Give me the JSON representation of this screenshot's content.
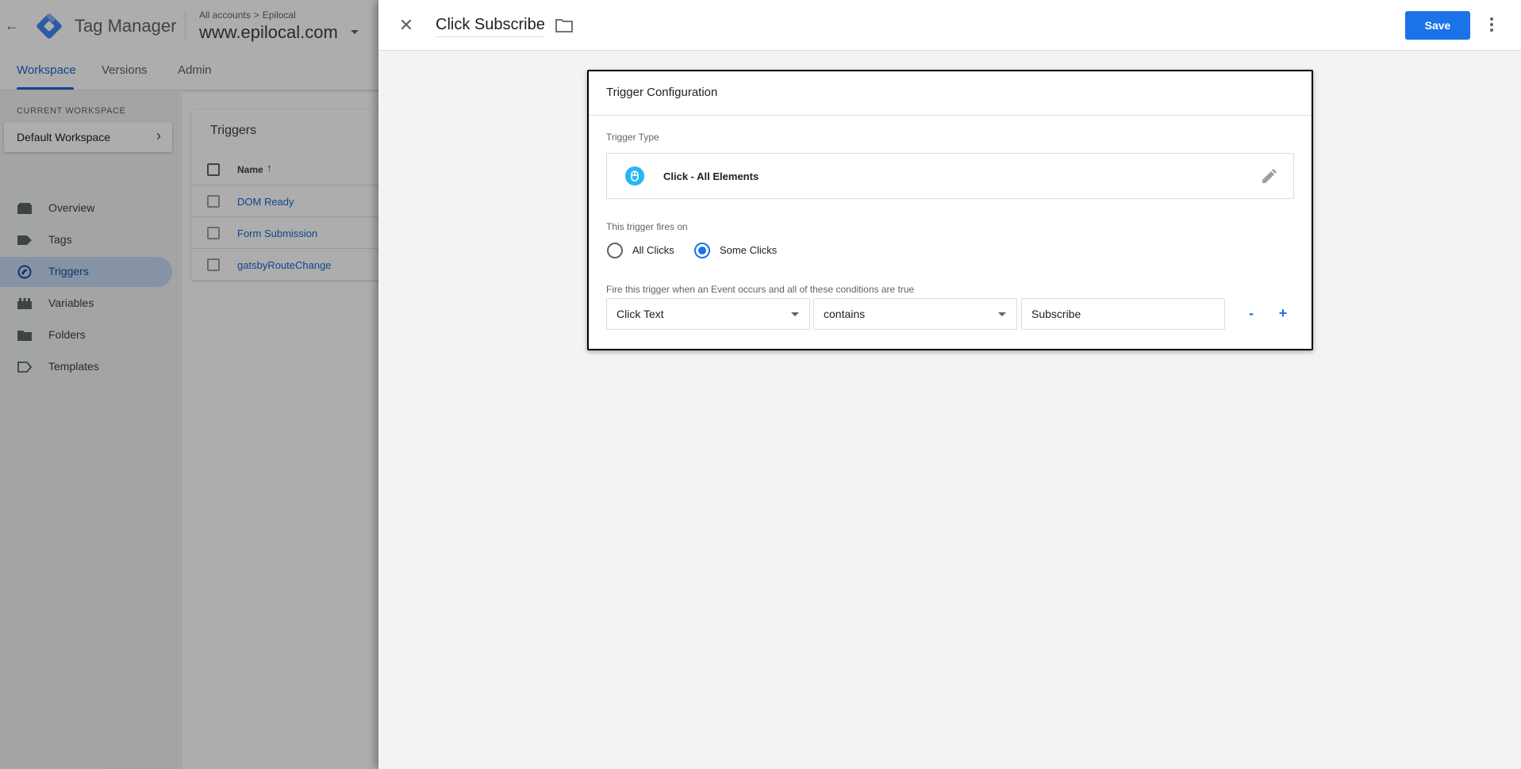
{
  "app": {
    "title": "Tag Manager",
    "breadcrumb_root": "All accounts",
    "breadcrumb_sep": ">",
    "breadcrumb_account": "Epilocal",
    "container_name": "www.epilocal.com"
  },
  "nav_tabs": [
    {
      "label": "Workspace",
      "active": true
    },
    {
      "label": "Versions",
      "active": false
    },
    {
      "label": "Admin",
      "active": false
    }
  ],
  "sidebar": {
    "workspace_label": "CURRENT WORKSPACE",
    "workspace_name": "Default Workspace",
    "items": [
      {
        "label": "Overview",
        "icon": "overview-icon",
        "active": false
      },
      {
        "label": "Tags",
        "icon": "tag-icon",
        "active": false
      },
      {
        "label": "Triggers",
        "icon": "trigger-icon",
        "active": true
      },
      {
        "label": "Variables",
        "icon": "variables-icon",
        "active": false
      },
      {
        "label": "Folders",
        "icon": "folder-icon",
        "active": false
      },
      {
        "label": "Templates",
        "icon": "templates-icon",
        "active": false
      }
    ]
  },
  "triggers_list": {
    "title": "Triggers",
    "column_name": "Name",
    "sort_symbol": "↑",
    "rows": [
      "DOM Ready",
      "Form Submission",
      "gatsbyRouteChange"
    ]
  },
  "panel": {
    "close_symbol": "✕",
    "trigger_name": "Click Subscribe",
    "save_label": "Save",
    "accent_color": "#1a73e8"
  },
  "config": {
    "title": "Trigger Configuration",
    "type_label": "Trigger Type",
    "type_name": "Click - All Elements",
    "fires_on_label": "This trigger fires on",
    "fires_on_options": [
      {
        "label": "All Clicks",
        "selected": false
      },
      {
        "label": "Some Clicks",
        "selected": true
      }
    ],
    "conditions_label": "Fire this trigger when an Event occurs and all of these conditions are true",
    "condition": {
      "variable": "Click Text",
      "operator": "contains",
      "value": "Subscribe"
    },
    "remove_label": "-",
    "add_label": "+"
  }
}
